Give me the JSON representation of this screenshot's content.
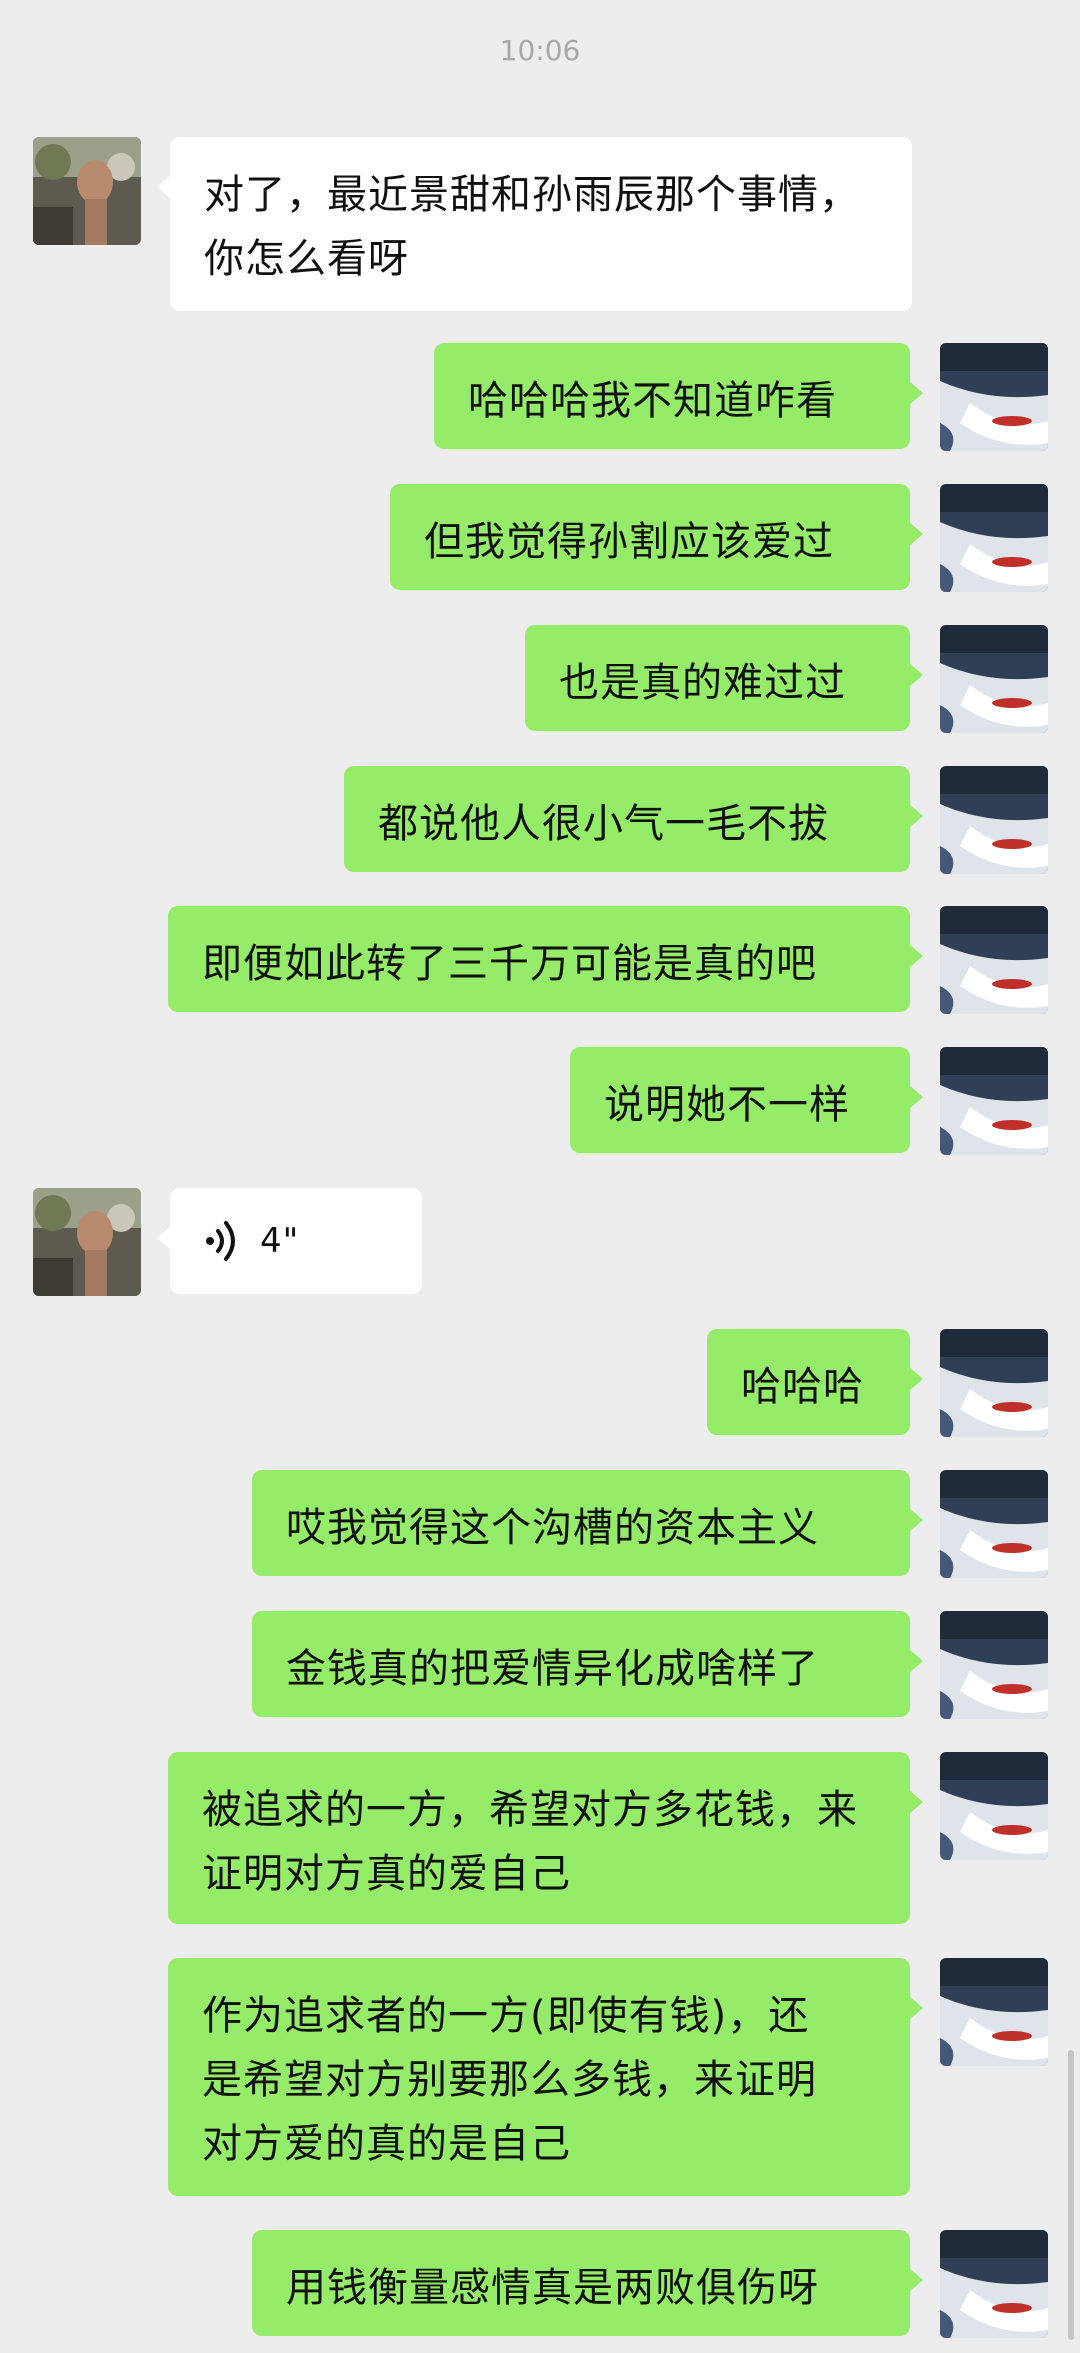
{
  "chat": {
    "time": "10:06",
    "messages": [
      {
        "side": "in",
        "text": "对了，最近景甜和孙雨辰那个事情，\n你怎么看呀"
      },
      {
        "side": "out",
        "text": "哈哈哈我不知道咋看"
      },
      {
        "side": "out",
        "text": "但我觉得孙割应该爱过"
      },
      {
        "side": "out",
        "text": "也是真的难过过"
      },
      {
        "side": "out",
        "text": "都说他人很小气一毛不拔"
      },
      {
        "side": "out",
        "text": "即便如此转了三千万可能是真的吧"
      },
      {
        "side": "out",
        "text": "说明她不一样"
      },
      {
        "side": "in",
        "type": "voice",
        "text": "4\""
      },
      {
        "side": "out",
        "text": "哈哈哈"
      },
      {
        "side": "out",
        "text": "哎我觉得这个沟槽的资本主义"
      },
      {
        "side": "out",
        "text": "金钱真的把爱情异化成啥样了"
      },
      {
        "side": "out",
        "text": "被追求的一方，希望对方多花钱，来\n证明对方真的爱自己"
      },
      {
        "side": "out",
        "text": "作为追求者的一方(即使有钱)，还\n是希望对方别要那么多钱，来证明\n对方爱的真的是自己"
      },
      {
        "side": "out",
        "text": "用钱衡量感情真是两败俱伤呀"
      }
    ]
  },
  "colors": {
    "background": "#ededed",
    "incoming_bubble": "#ffffff",
    "outgoing_bubble": "#95ec69",
    "timestamp": "#a8a8a8"
  },
  "icons": {
    "incoming_avatar": "contact-avatar-photo",
    "outgoing_avatar": "self-avatar-photo",
    "voice": "voice-wave-icon"
  }
}
